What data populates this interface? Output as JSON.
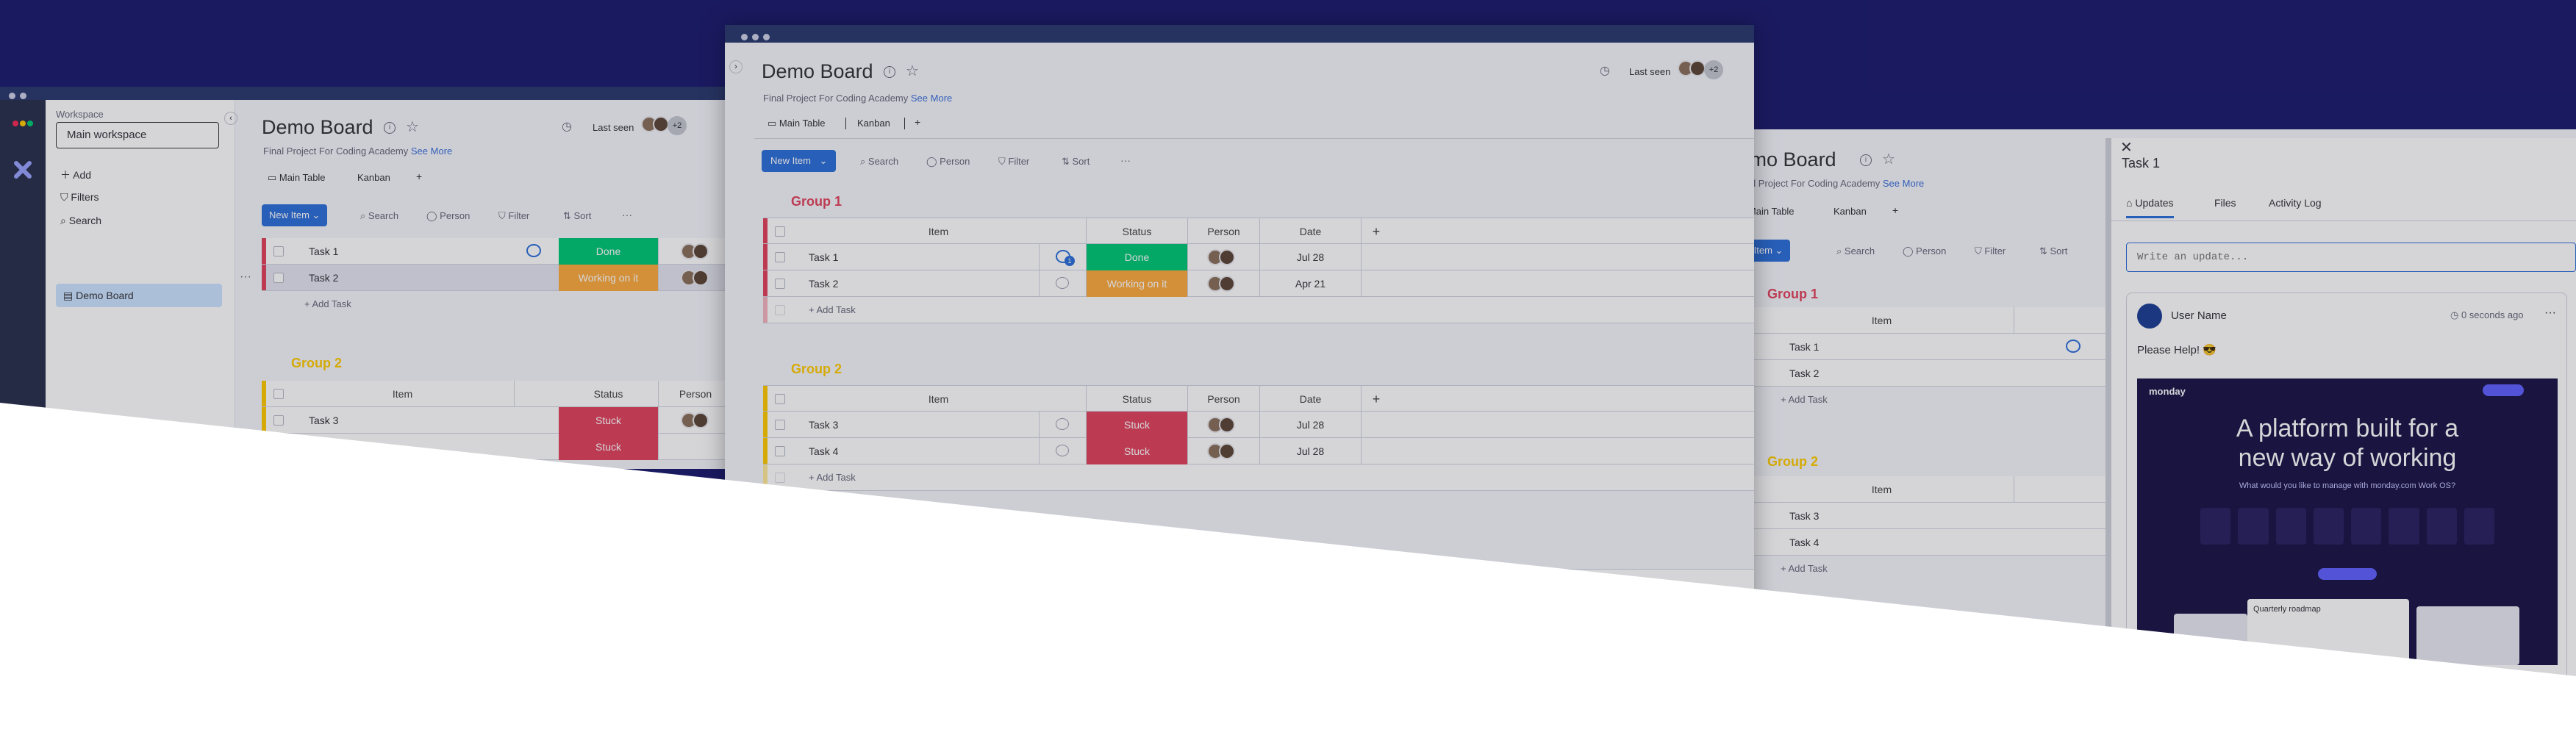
{
  "board": {
    "title": "Demo Board",
    "description": "Final Project For Coding Academy",
    "see_more": "See More",
    "last_seen": "Last seen",
    "more_people": "+2"
  },
  "views": {
    "main_table": "Main Table",
    "kanban": "Kanban",
    "add": "+"
  },
  "toolbar": {
    "new_item": "New Item",
    "search": "Search",
    "person": "Person",
    "filter": "Filter",
    "sort": "Sort",
    "more": "···"
  },
  "columns": {
    "item": "Item",
    "status": "Status",
    "person": "Person",
    "date": "Date",
    "add": "+"
  },
  "groups": [
    {
      "title": "Group 1",
      "color": "#e2445c",
      "tasks": [
        {
          "name": "Task 1",
          "status": "Done",
          "status_color": "#00c875",
          "date": "Jul 28",
          "updates": "1"
        },
        {
          "name": "Task 2",
          "status": "Working on it",
          "status_color": "#fdab3d",
          "date": "Apr 21"
        }
      ],
      "add_task": "+ Add Task"
    },
    {
      "title": "Group 2",
      "color": "#ffcb00",
      "tasks": [
        {
          "name": "Task 3",
          "status": "Stuck",
          "status_color": "#e2445c",
          "date": "Jul 28"
        },
        {
          "name": "Task 4",
          "status": "Stuck",
          "status_color": "#e2445c",
          "date": "Jul 28"
        }
      ],
      "add_task": "+ Add Task"
    }
  ],
  "sidebar": {
    "workspace_label": "Workspace",
    "workspace_value": "Main workspace",
    "add": "Add",
    "filters": "Filters",
    "search": "Search",
    "board_item": "Demo Board"
  },
  "panel": {
    "title": "Task 1",
    "tabs": [
      "Updates",
      "Files",
      "Activity Log"
    ],
    "write_placeholder": "Write an update...",
    "user_name": "User Name",
    "time_ago": "0 seconds ago",
    "message": "Please Help! 😎"
  },
  "preview": {
    "brand": "monday",
    "headline_1": "A platform built for a",
    "headline_2": "new way of working",
    "tagline": "What would you like to manage with monday.com Work OS?",
    "card_title": "Quarterly roadmap"
  }
}
